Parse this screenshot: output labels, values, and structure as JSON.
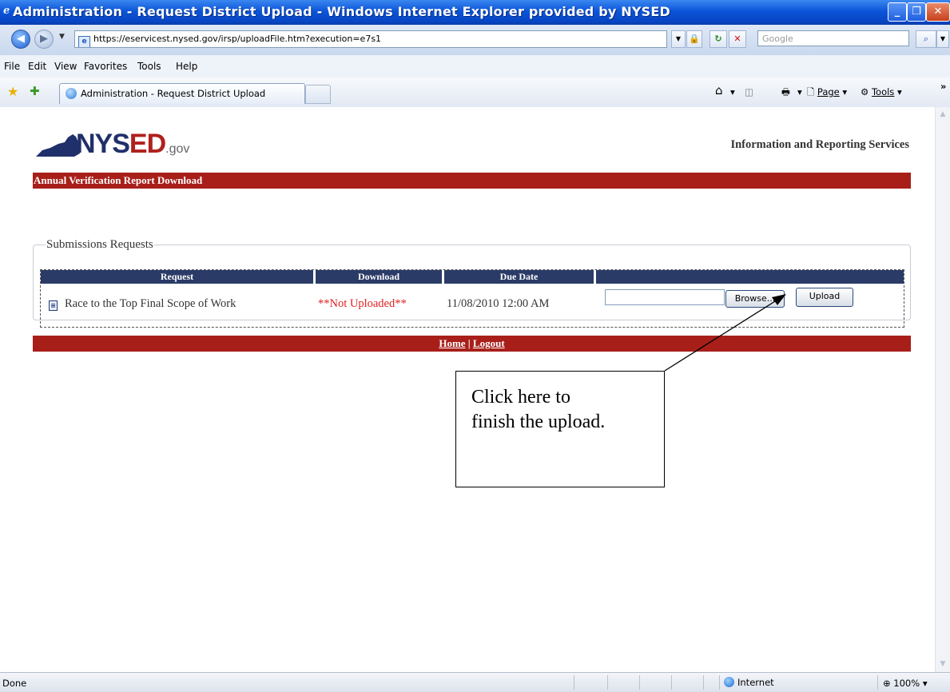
{
  "window": {
    "title": "Administration - Request District Upload - Windows Internet Explorer provided by NYSED"
  },
  "addressbar": {
    "url": "https://eservicest.nysed.gov/irsp/uploadFile.htm?execution=e7s1",
    "search_placeholder": "Google"
  },
  "menubar": [
    "File",
    "Edit",
    "View",
    "Favorites",
    "Tools",
    "Help"
  ],
  "tab": {
    "title": "Administration - Request District Upload"
  },
  "commandbar": {
    "page": "Page",
    "tools": "Tools"
  },
  "page": {
    "logo": {
      "main": "NYS",
      "accent": "ED",
      "suffix": ".gov"
    },
    "header_right": "Information and Reporting Services",
    "banner_title": "Annual Verification Report Download",
    "fieldset_legend": "Submissions Requests",
    "table": {
      "headers": [
        "Request",
        "Download",
        "Due Date",
        ""
      ],
      "row": {
        "request": "Race to the Top Final Scope of Work",
        "download": "**Not Uploaded**",
        "due_date": "11/08/2010 12:00 AM",
        "browse_label": "Browse...",
        "upload_label": "Upload"
      }
    },
    "footer_links": {
      "home": "Home",
      "separator": "|",
      "logout": "Logout"
    }
  },
  "callout": {
    "line1": "Click here to",
    "line2": "finish the upload."
  },
  "statusbar": {
    "status": "Done",
    "zone": "Internet",
    "zoom": "100%"
  },
  "colors": {
    "banner": "#a81f1a",
    "table_header": "#2b3b67",
    "not_uploaded": "#e02020"
  }
}
